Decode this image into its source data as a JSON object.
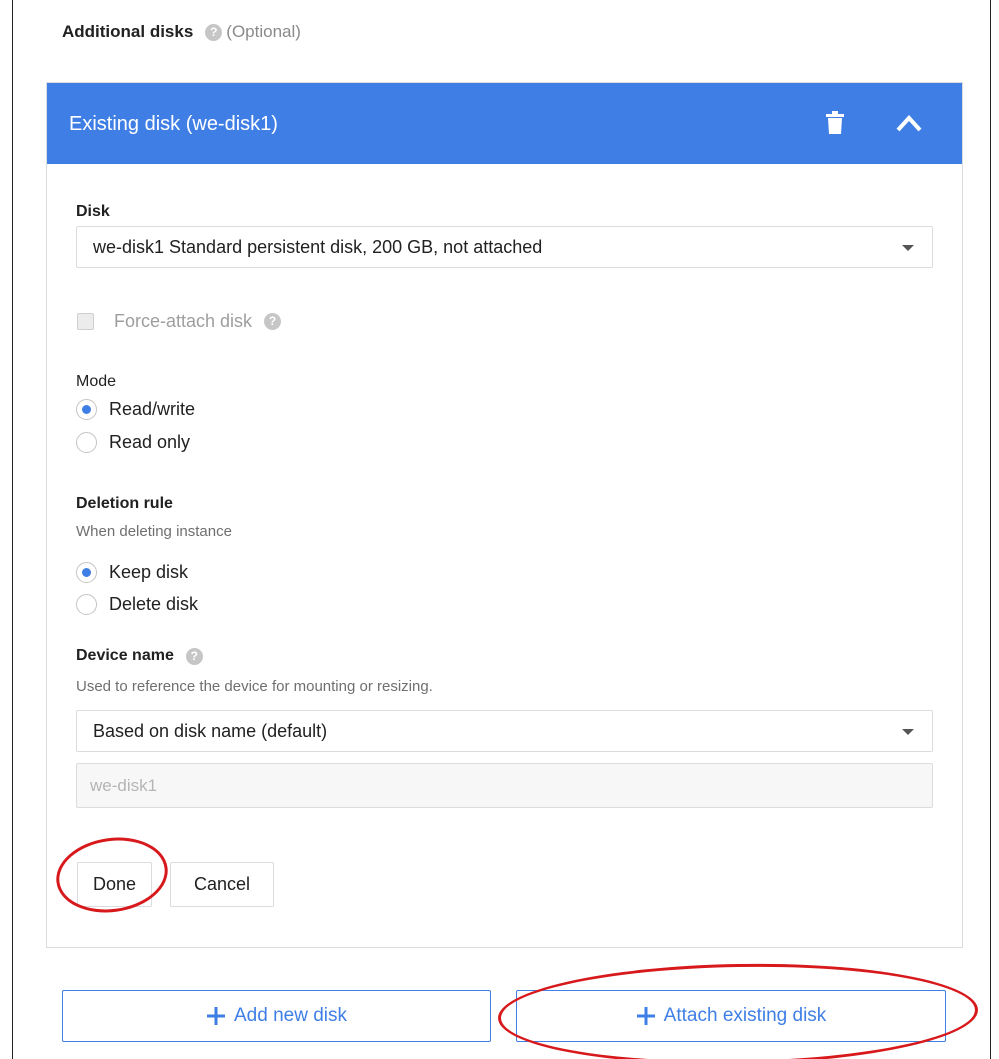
{
  "section": {
    "title": "Additional disks",
    "optional": "(Optional)",
    "help_icon": "question-circle-icon"
  },
  "card": {
    "title": "Existing disk (we-disk1)",
    "header_color": "#3f7fe5",
    "delete_icon": "trash-icon",
    "collapse_icon": "chevron-up-icon"
  },
  "disk": {
    "label": "Disk",
    "selected": "we-disk1 Standard persistent disk, 200 GB, not attached"
  },
  "force_attach": {
    "label": "Force-attach disk",
    "checked": false,
    "disabled": true
  },
  "mode": {
    "label": "Mode",
    "options": [
      "Read/write",
      "Read only"
    ],
    "selected": "Read/write"
  },
  "deletion_rule": {
    "label": "Deletion rule",
    "hint": "When deleting instance",
    "options": [
      "Keep disk",
      "Delete disk"
    ],
    "selected": "Keep disk"
  },
  "device_name": {
    "label": "Device name",
    "hint": "Used to reference the device for mounting or resizing.",
    "selected": "Based on disk name (default)",
    "input_value": "we-disk1"
  },
  "actions": {
    "done": "Done",
    "cancel": "Cancel"
  },
  "footer": {
    "add_new_disk": "Add new disk",
    "attach_existing_disk": "Attach existing disk",
    "accent_color": "#3f7fe5"
  },
  "annotations": {
    "color": "#d7191c"
  }
}
